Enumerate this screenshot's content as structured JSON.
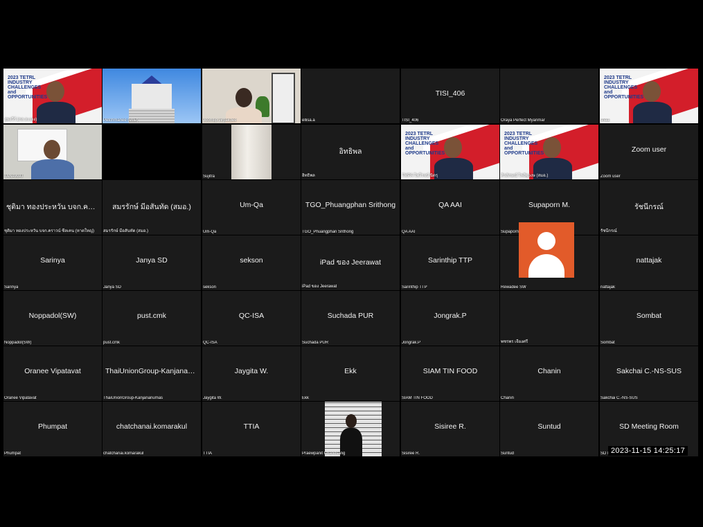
{
  "timestamp": "2023-11-15  14:25:17",
  "slide_title": "2023 TETRL INDUSTRY CHALLENGES and OPPORTUNITIES",
  "tiles": {
    "r1c1": {
      "label": "สุพงวีร์ (กล.ละเอง)"
    },
    "r1c2": {
      "label": "Petchmanee (VnP)"
    },
    "r1c3": {
      "label": "Joomtip Jirpakdee"
    },
    "r1c4": {
      "label": "ellisa.a"
    },
    "r1c5": {
      "name": "TISI_406",
      "label": "TISI_406"
    },
    "r1c6": {
      "label": "Oraya Perfect Myanmar"
    },
    "r1c7": {
      "label": "sfiaa."
    },
    "r2c1": {
      "label": "TANAWAT"
    },
    "r2c2": {
      "label": ""
    },
    "r2c3": {
      "label": "Sujitra"
    },
    "r2c4": {
      "name": "อิทธิพล",
      "label": "อิทธิพล"
    },
    "r2c5": {
      "label": "TMPA-ไพโรจน์ นิตรุ"
    },
    "r2c6": {
      "label": "ศิวลักษณ์ ไพสิฐวงษ (สมอ.)"
    },
    "r2c7": {
      "name": "Zoom user",
      "label": "Zoom user"
    },
    "r3c1": {
      "name": "ชุติมา ทองประหวัน บจก.คราวน์...",
      "label": "ชุติมา ทองประหวัน บจก.คราวน์ ซีลเคน (หาดใหญ่)"
    },
    "r3c2": {
      "name": "สมรรักษ์ มีอสันทัด (สมอ.)",
      "label": "สมรรักษ์ มีอสันทัด (สมอ.)"
    },
    "r3c3": {
      "name": "Um-Qa",
      "label": "Um-Qa"
    },
    "r3c4": {
      "name": "TGO_Phuangphan Srithong",
      "label": "TGO_Phuangphan Srithong"
    },
    "r3c5": {
      "name": "QA AAI",
      "label": "QA AAI"
    },
    "r3c6": {
      "name": "Supaporn M.",
      "label": "Supaporn M."
    },
    "r3c7": {
      "name": "รัชนีกรณ์",
      "label": "รัชนีกรณ์"
    },
    "r4c1": {
      "name": "Sarinya",
      "label": "Sarinya"
    },
    "r4c2": {
      "name": "Janya SD",
      "label": "Janya SD"
    },
    "r4c3": {
      "name": "sekson",
      "label": "sekson"
    },
    "r4c4": {
      "name": "iPad ของ Jeerawat",
      "label": "iPad ของ Jeerawat"
    },
    "r4c5": {
      "name": "Sarinthip TTP",
      "label": "Sarinthip TTP"
    },
    "r4c6": {
      "name": "Rewadee SW",
      "label": "Rewadee SW"
    },
    "r4c7": {
      "name": "nattajak",
      "label": "nattajak"
    },
    "r5c1": {
      "name": "Noppadol(SW)",
      "label": "Noppadol(SW)"
    },
    "r5c2": {
      "name": "pust.cmk",
      "label": "pust.cmk"
    },
    "r5c3": {
      "name": "QC-ISA",
      "label": "QC-ISA"
    },
    "r5c4": {
      "name": "Suchada PUR",
      "label": "Suchada PUR"
    },
    "r5c5": {
      "name": "Jongrak.P",
      "label": "Jongrak.P"
    },
    "r5c6": {
      "label": "พชรพร เจียงศรี"
    },
    "r5c7": {
      "name": "Sombat",
      "label": "Sombat"
    },
    "r6c1": {
      "name": "Oranee Vipatavat",
      "label": "Oranee Vipatavat"
    },
    "r6c2": {
      "name": "ThaiUnionGroup-Kanjananu...",
      "label": "ThaiUnionGroup-Kanjananumas"
    },
    "r6c3": {
      "name": "Jaygita W.",
      "label": "Jaygita W."
    },
    "r6c4": {
      "name": "Ekk",
      "label": "Ekk"
    },
    "r6c5": {
      "name": "SIAM TIN FOOD",
      "label": "SIAM TIN FOOD"
    },
    "r6c6": {
      "name": "Chanin",
      "label": "Chanin"
    },
    "r6c7": {
      "name": "Sakchai C.-NS-SUS",
      "label": "Sakchai C.-NS-SUS"
    },
    "r7c1": {
      "name": "Phumpat",
      "label": "Phumpat"
    },
    "r7c2": {
      "name": "chatchanai.komarakul",
      "label": "chatchanai.komarakul"
    },
    "r7c3": {
      "name": "TTIA",
      "label": "TTIA"
    },
    "r7c4": {
      "label": "Praewpanit Chandsang"
    },
    "r7c5": {
      "name": "Sisiree R.",
      "label": "Sisiree R."
    },
    "r7c6": {
      "name": "Suntud",
      "label": "Suntud"
    },
    "r7c7": {
      "name": "SD Meeting Room",
      "label": "SD Meeting Room"
    }
  },
  "icons": {
    "avatar": "person-avatar-icon"
  },
  "colors": {
    "background": "#1b1b1b",
    "avatar_bg": "#e25b2a",
    "slide_red": "#d31e2a"
  }
}
